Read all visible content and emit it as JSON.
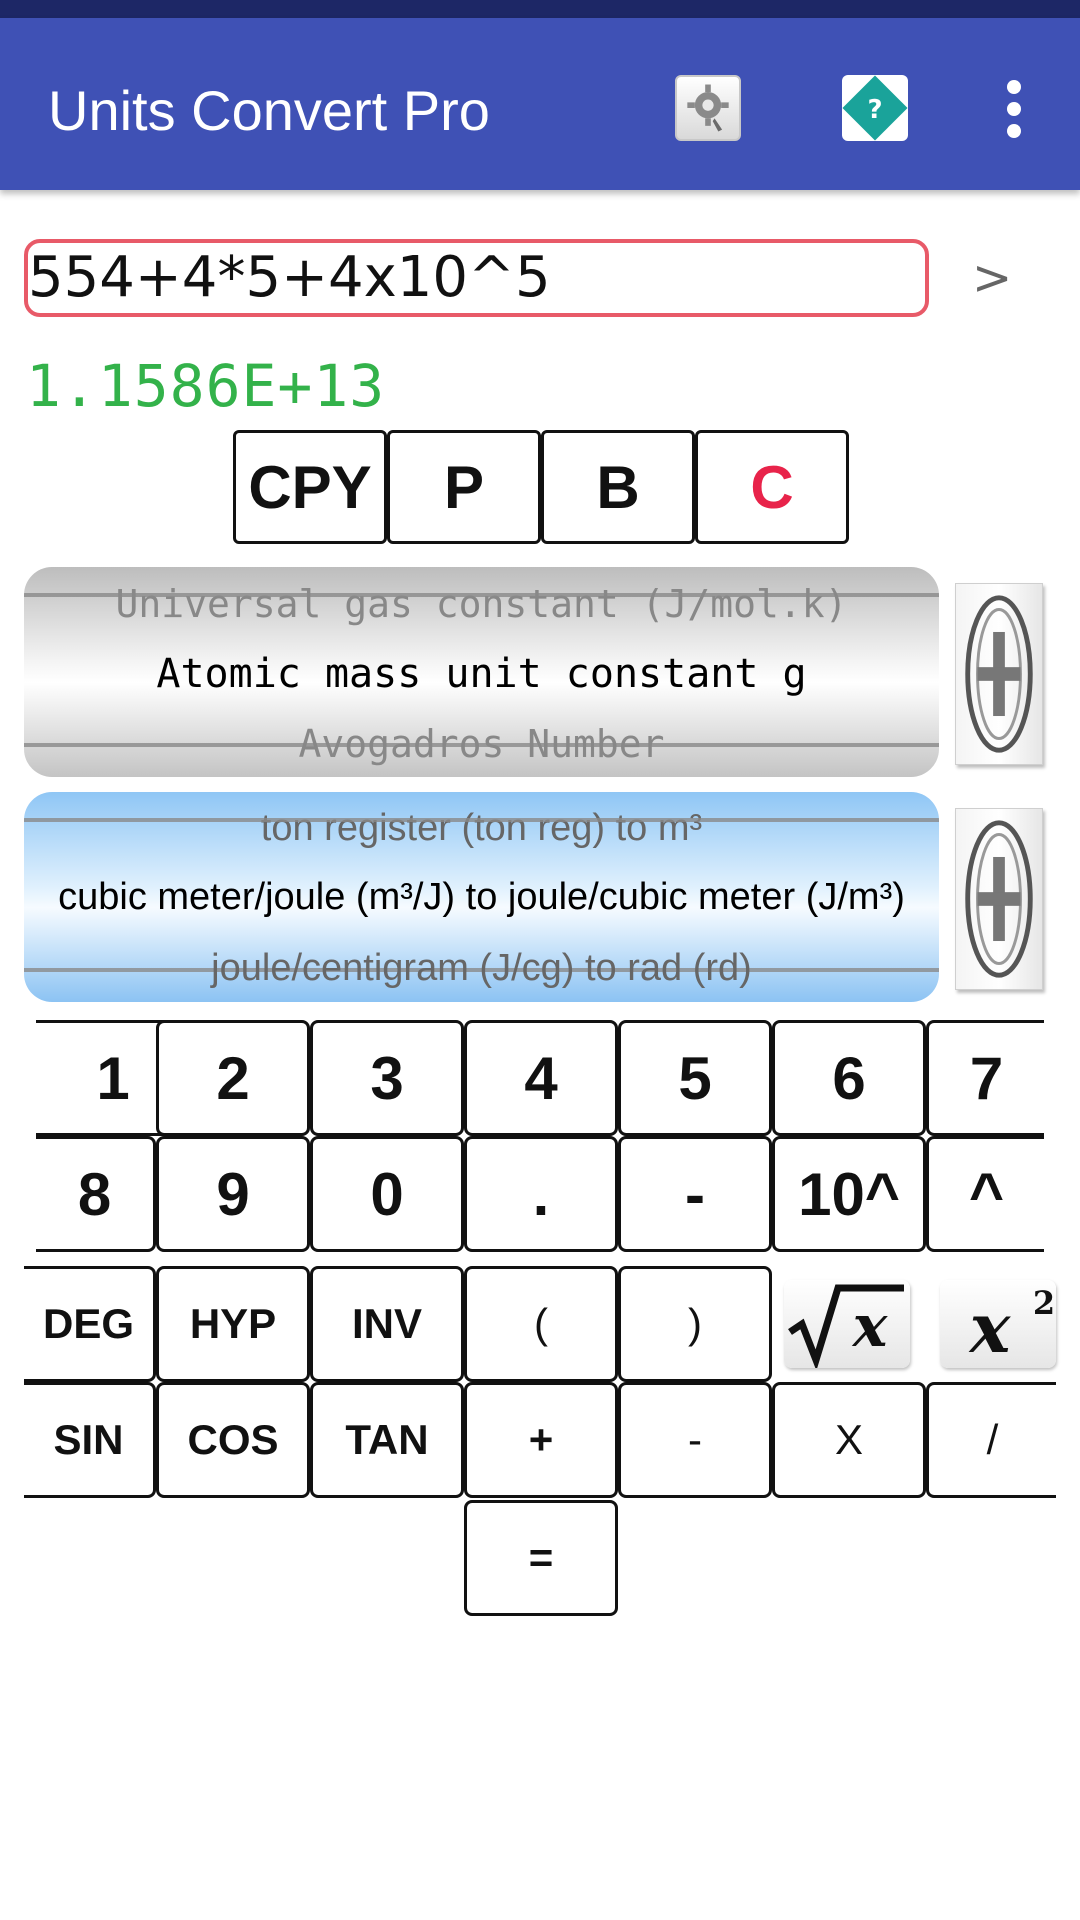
{
  "app_bar": {
    "title": "Units Convert Pro",
    "icons": [
      "gear-icon",
      "help-icon",
      "more-vertical-icon"
    ],
    "background": "#3f51b5"
  },
  "calculator": {
    "expression": "554+4*5+4x10^5",
    "go_label": ">",
    "result": "1.1586E+13",
    "result_color": "#33b24a",
    "actions": {
      "copy": "CPY",
      "p": "P",
      "b": "B",
      "clear": "C"
    }
  },
  "constant_wheel": {
    "above": "Universal gas constant (J/mol.k)",
    "selected": "Atomic mass unit constant g",
    "below": "Avogadros Number"
  },
  "unit_wheel": {
    "above": "ton register (ton reg)  to m³",
    "selected": "cubic meter/joule (m³/J) to joule/cubic meter (J/m³)",
    "below": "joule/centigram (J/cg) to  rad (rd)"
  },
  "keypad": {
    "row1": [
      "1",
      "2",
      "3",
      "4",
      "5",
      "6",
      "7"
    ],
    "row2": [
      "8",
      "9",
      "0",
      ".",
      "-",
      "10^",
      "^"
    ],
    "row3": [
      "DEG",
      "HYP",
      "INV",
      "(",
      ")"
    ],
    "row4": [
      "SIN",
      "COS",
      "TAN",
      "+",
      "-",
      "X",
      "/"
    ],
    "equals": "="
  }
}
